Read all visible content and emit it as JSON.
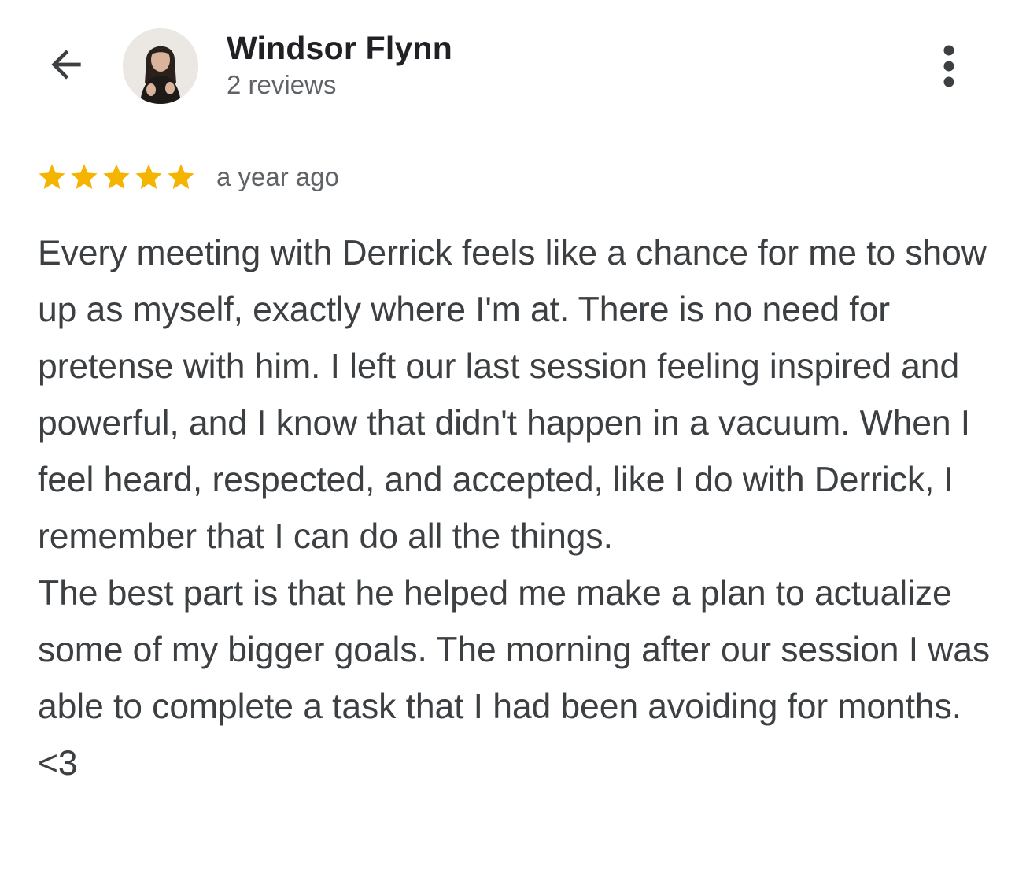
{
  "header": {
    "reviewer_name": "Windsor Flynn",
    "review_count": "2 reviews",
    "back_icon": "arrow-back-icon",
    "more_icon": "more-vert-icon"
  },
  "review": {
    "rating": 5,
    "max_rating": 5,
    "timestamp": "a year ago",
    "paragraph_1": "Every meeting with Derrick feels like a chance for me to show up as myself, exactly where I'm at. There is no need for pretense with him. I left our last session feeling inspired and powerful, and I know that didn't happen in a vacuum. When I feel heard, respected, and accepted, like I do with Derrick, I remember that I can do all the things.",
    "paragraph_2": "The best part is that he helped me make a plan to actualize some of my bigger goals. The morning after our session I was able to complete a task that I had been avoiding for months. <3"
  },
  "colors": {
    "star": "#f4b400",
    "name": "#202124",
    "secondary": "#5f6368",
    "body": "#3c4043"
  }
}
